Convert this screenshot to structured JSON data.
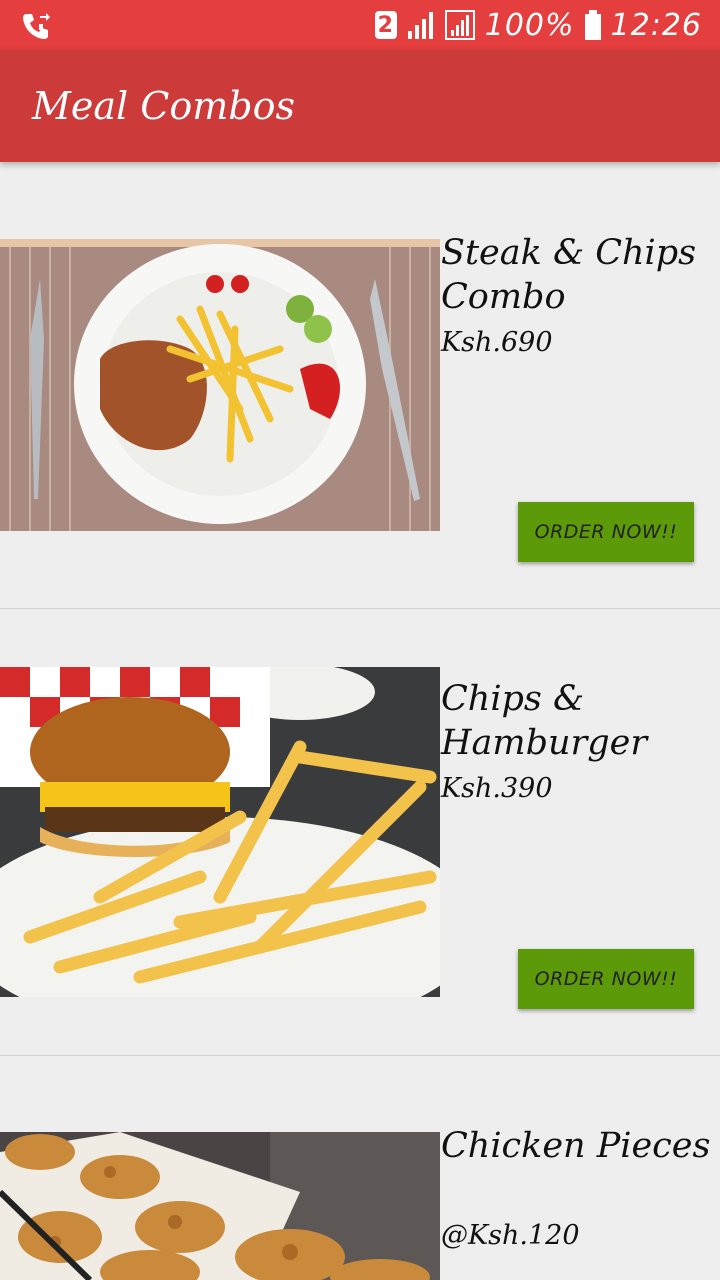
{
  "status_bar": {
    "sim_slot": "2",
    "battery": "100%",
    "time": "12:26",
    "icons": [
      "call-forward-icon",
      "signal-icon",
      "signal-icon",
      "battery-icon"
    ]
  },
  "app_bar": {
    "title": "Meal Combos"
  },
  "items": [
    {
      "name": "Steak & Chips Combo",
      "price": "Ksh.690",
      "button": "ORDER NOW!!",
      "image": "steak-chips-photo"
    },
    {
      "name": "Chips & Hamburger",
      "price": "Ksh.390",
      "button": "ORDER NOW!!",
      "image": "burger-chips-photo"
    },
    {
      "name": "Chicken Pieces",
      "price": "@Ksh.120",
      "image": "chicken-pieces-photo"
    }
  ]
}
